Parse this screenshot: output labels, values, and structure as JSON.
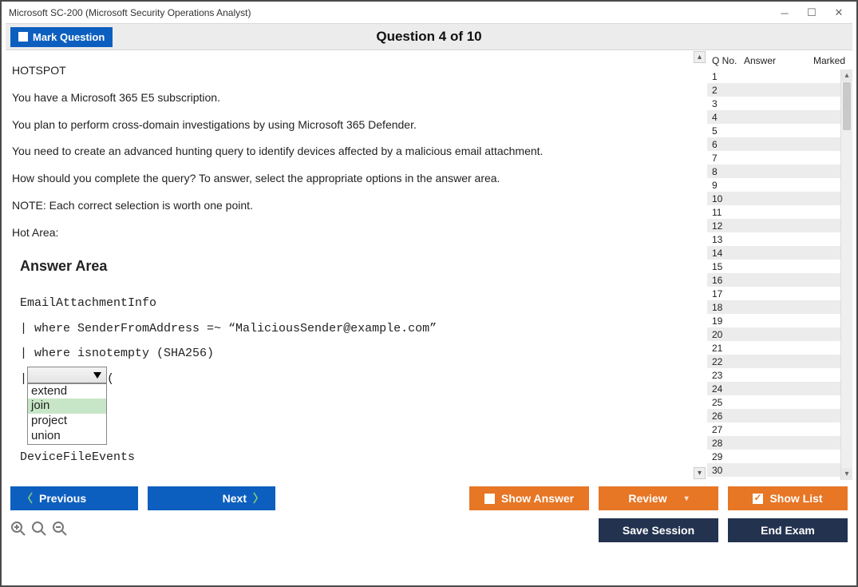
{
  "title": "Microsoft SC-200 (Microsoft Security Operations Analyst)",
  "toolbar": {
    "mark_label": "Mark Question",
    "question_title": "Question 4 of 10"
  },
  "question": {
    "tag": "HOTSPOT",
    "p1": "You have a Microsoft 365 E5 subscription.",
    "p2": "You plan to perform cross-domain investigations by using Microsoft 365 Defender.",
    "p3": "You need to create an advanced hunting query to identify devices affected by a malicious email attachment.",
    "p4": "How should you complete the query? To answer, select the appropriate options in the answer area.",
    "p5": "NOTE: Each correct selection is worth one point.",
    "p6": "Hot Area:",
    "answer_heading": "Answer Area"
  },
  "code": {
    "l1": "EmailAttachmentInfo",
    "l2": "| where SenderFromAddress =~ “MaliciousSender@example.com”",
    "l3": "| where isnotempty (SHA256)",
    "l4_pre": "| ",
    "l4_post": " (",
    "dropdown_options": [
      "extend",
      "join",
      "project",
      "union"
    ],
    "dropdown_selected": "join",
    "l5": "DeviceFileEvents"
  },
  "side": {
    "h1": "Q No.",
    "h2": "Answer",
    "h3": "Marked",
    "rows": [
      1,
      2,
      3,
      4,
      5,
      6,
      7,
      8,
      9,
      10,
      11,
      12,
      13,
      14,
      15,
      16,
      17,
      18,
      19,
      20,
      21,
      22,
      23,
      24,
      25,
      26,
      27,
      28,
      29,
      30
    ]
  },
  "footer": {
    "previous": "Previous",
    "next": "Next",
    "show_answer": "Show Answer",
    "review": "Review",
    "show_list": "Show List",
    "save_session": "Save Session",
    "end_exam": "End Exam"
  }
}
